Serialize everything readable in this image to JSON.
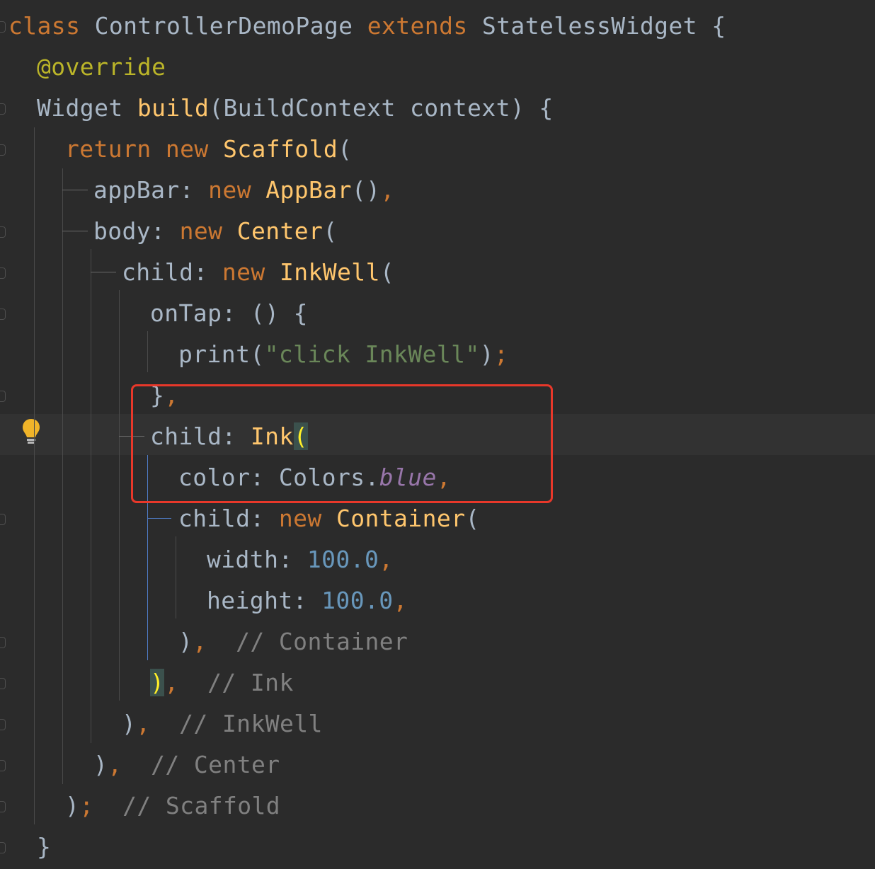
{
  "code": {
    "l01_kw1": "class",
    "l01_name": "ControllerDemoPage",
    "l01_kw2": "extends",
    "l01_base": "StatelessWidget",
    "l01_brace": "{",
    "l02_ann": "@override",
    "l03_type": "Widget",
    "l03_method": "build",
    "l03_rest": "(BuildContext context) {",
    "l04_kw": "return new",
    "l04_cls": "Scaffold",
    "l04_paren": "(",
    "l05_prop": "appBar: ",
    "l05_kw": "new",
    "l05_cls": "AppBar",
    "l05_rest": "()",
    "l05_comma": ",",
    "l06_prop": "body: ",
    "l06_kw": "new",
    "l06_cls": "Center",
    "l06_paren": "(",
    "l07_prop": "child: ",
    "l07_kw": "new",
    "l07_cls": "InkWell",
    "l07_paren": "(",
    "l08_text": "onTap: () {",
    "l09_fn": "print(",
    "l09_str": "\"click InkWell\"",
    "l09_close": ")",
    "l09_semi": ";",
    "l10_brace": "}",
    "l10_comma": ",",
    "l11_prop": "child: ",
    "l11_cls": "Ink",
    "l11_paren": "(",
    "l12_prop": "color: Colors.",
    "l12_const": "blue",
    "l12_comma": ",",
    "l13_prop": "child: ",
    "l13_kw": "new",
    "l13_cls": "Container",
    "l13_paren": "(",
    "l14_prop": "width: ",
    "l14_num": "100.0",
    "l14_comma": ",",
    "l15_prop": "height: ",
    "l15_num": "100.0",
    "l15_comma": ",",
    "l16_close": ")",
    "l16_comma": ",",
    "l16_cmt": "// Container",
    "l17_close": ")",
    "l17_comma": ",",
    "l17_cmt": "// Ink",
    "l18_close": ")",
    "l18_comma": ",",
    "l18_cmt": "// InkWell",
    "l19_close": ")",
    "l19_comma": ",",
    "l19_cmt": "// Center",
    "l20_close": ")",
    "l20_semi": ";",
    "l20_cmt": "// Scaffold",
    "l21_brace": "}"
  },
  "colors": {
    "background": "#2b2b2b",
    "current_line": "#323232",
    "default_text": "#a9b7c6",
    "keyword": "#cc7832",
    "class_name": "#ffc66d",
    "annotation": "#bbb529",
    "string": "#6a8759",
    "number": "#6897bb",
    "comment": "#808080",
    "constant": "#9876aa",
    "highlight_box": "#e8382a",
    "indent_guide_active": "#4f7cc7"
  },
  "icons": {
    "intention": "lightbulb-icon"
  }
}
